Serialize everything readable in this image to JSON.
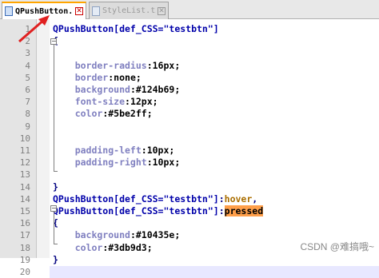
{
  "tabs": [
    {
      "label": "QPushButton.css",
      "active": true
    },
    {
      "label": "StyleList.txt",
      "active": false
    }
  ],
  "lines": [
    {
      "n": "1",
      "parts": [
        {
          "t": "QPushButton[def_CSS=\"testbtn\"]",
          "c": "sel"
        }
      ]
    },
    {
      "n": "2",
      "parts": [
        {
          "t": "{",
          "c": "op"
        }
      ]
    },
    {
      "n": "3",
      "parts": []
    },
    {
      "n": "4",
      "parts": [
        {
          "t": "    border-radius",
          "c": "prop"
        },
        {
          "t": ":16px;",
          "c": "val"
        }
      ]
    },
    {
      "n": "5",
      "parts": [
        {
          "t": "    border",
          "c": "prop"
        },
        {
          "t": ":none;",
          "c": "val"
        }
      ]
    },
    {
      "n": "6",
      "parts": [
        {
          "t": "    background",
          "c": "prop"
        },
        {
          "t": ":#124b69;",
          "c": "val"
        }
      ]
    },
    {
      "n": "7",
      "parts": [
        {
          "t": "    font-size",
          "c": "prop"
        },
        {
          "t": ":12px;",
          "c": "val"
        }
      ]
    },
    {
      "n": "8",
      "parts": [
        {
          "t": "    color",
          "c": "prop"
        },
        {
          "t": ":#5be2ff;",
          "c": "val"
        }
      ]
    },
    {
      "n": "9",
      "parts": []
    },
    {
      "n": "10",
      "parts": []
    },
    {
      "n": "11",
      "parts": [
        {
          "t": "    padding-left",
          "c": "prop"
        },
        {
          "t": ":10px;",
          "c": "val"
        }
      ]
    },
    {
      "n": "12",
      "parts": [
        {
          "t": "    padding-right",
          "c": "prop"
        },
        {
          "t": ":10px;",
          "c": "val"
        }
      ]
    },
    {
      "n": "13",
      "parts": []
    },
    {
      "n": "14",
      "parts": [
        {
          "t": "}",
          "c": "op"
        }
      ]
    },
    {
      "n": "14",
      "parts": [
        {
          "t": "QPushButton[def_CSS=\"testbtn\"]",
          "c": "sel"
        },
        {
          "t": ":",
          "c": "op"
        },
        {
          "t": "hover",
          "c": "pseudo"
        },
        {
          "t": ",",
          "c": "op"
        }
      ]
    },
    {
      "n": "15",
      "parts": [
        {
          "t": "QPushButton[def_CSS=\"testbtn\"]",
          "c": "sel"
        },
        {
          "t": ":",
          "c": "op"
        },
        {
          "t": "pressed",
          "c": "pseudo mark"
        }
      ]
    },
    {
      "n": "16",
      "parts": [
        {
          "t": "{",
          "c": "op"
        }
      ]
    },
    {
      "n": "17",
      "parts": [
        {
          "t": "    background",
          "c": "prop"
        },
        {
          "t": ":#10435e;",
          "c": "val"
        }
      ]
    },
    {
      "n": "18",
      "parts": [
        {
          "t": "    color",
          "c": "prop"
        },
        {
          "t": ":#3db9d3;",
          "c": "val"
        }
      ]
    },
    {
      "n": "19",
      "parts": [
        {
          "t": "}",
          "c": "op"
        }
      ]
    },
    {
      "n": "20",
      "parts": []
    }
  ],
  "current_line_index": 20,
  "watermark": "CSDN @难搞哦~"
}
